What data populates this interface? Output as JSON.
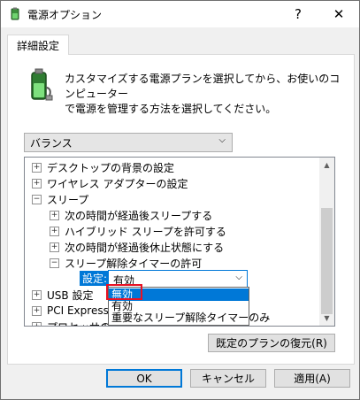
{
  "window": {
    "title": "電源オプション",
    "help_label": "?",
    "close_label": "✕"
  },
  "tab": {
    "label": "詳細設定"
  },
  "description": {
    "line1": "カスタマイズする電源プランを選択してから、お使いのコンピューター",
    "line2": "で電源を管理する方法を選択してください。"
  },
  "plan": {
    "selected": "バランス",
    "arrow": "⌵"
  },
  "tree": {
    "items": [
      {
        "label": "デスクトップの背景の設定",
        "expander": "+"
      },
      {
        "label": "ワイヤレス アダプターの設定",
        "expander": "+"
      },
      {
        "label": "スリープ",
        "expander": "−"
      },
      {
        "label": "次の時間が経過後スリープする",
        "expander": "+"
      },
      {
        "label": "ハイブリッド スリープを許可する",
        "expander": "+"
      },
      {
        "label": "次の時間が経過後休止状態にする",
        "expander": "+"
      },
      {
        "label": "スリープ解除タイマーの許可",
        "expander": "−"
      },
      {
        "label": "USB 設定",
        "expander": "+"
      },
      {
        "label": "PCI Express",
        "expander": "+"
      },
      {
        "label": "プロセッサの電源管理",
        "expander": "+"
      }
    ],
    "scroll_up": "▲",
    "scroll_down": "▼"
  },
  "setting": {
    "label": "設定:",
    "value": "有効",
    "arrow": "⌵",
    "options": [
      "無効",
      "有効",
      "重要なスリープ解除タイマーのみ"
    ],
    "selected_index": 0
  },
  "buttons": {
    "restore": "既定のプランの復元(R)",
    "ok": "OK",
    "cancel": "キャンセル",
    "apply": "適用(A)"
  },
  "colors": {
    "accent": "#0078d7",
    "highlight_box": "#e81123"
  }
}
